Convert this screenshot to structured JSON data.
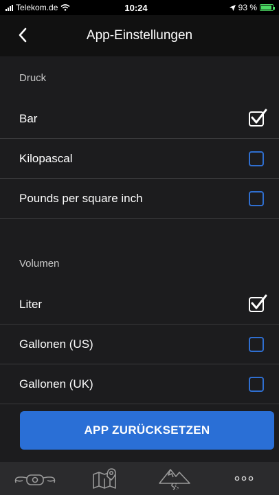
{
  "status_bar": {
    "carrier": "Telekom.de",
    "time": "10:24",
    "battery": "93 %",
    "battery_level": 0.93
  },
  "nav": {
    "title": "App-Einstellungen"
  },
  "sections": {
    "pressure": {
      "label": "Druck",
      "options": [
        {
          "label": "Bar",
          "checked": true
        },
        {
          "label": "Kilopascal",
          "checked": false
        },
        {
          "label": "Pounds per square inch",
          "checked": false
        }
      ]
    },
    "volume": {
      "label": "Volumen",
      "options": [
        {
          "label": "Liter",
          "checked": true
        },
        {
          "label": "Gallonen (US)",
          "checked": false
        },
        {
          "label": "Gallonen (UK)",
          "checked": false
        }
      ]
    }
  },
  "reset_button": {
    "label": "APP ZURÜCKSETZEN"
  },
  "tab_bar": {
    "tabs": [
      {
        "icon": "motorcycle-icon"
      },
      {
        "icon": "map-pin-icon"
      },
      {
        "icon": "mountain-road-icon"
      },
      {
        "icon": "more-dots-icon"
      }
    ]
  },
  "colors": {
    "accent": "#2a6fd6",
    "background": "#1c1c1e",
    "nav_background": "#111111",
    "tabbar_background": "#2b2b2d"
  }
}
